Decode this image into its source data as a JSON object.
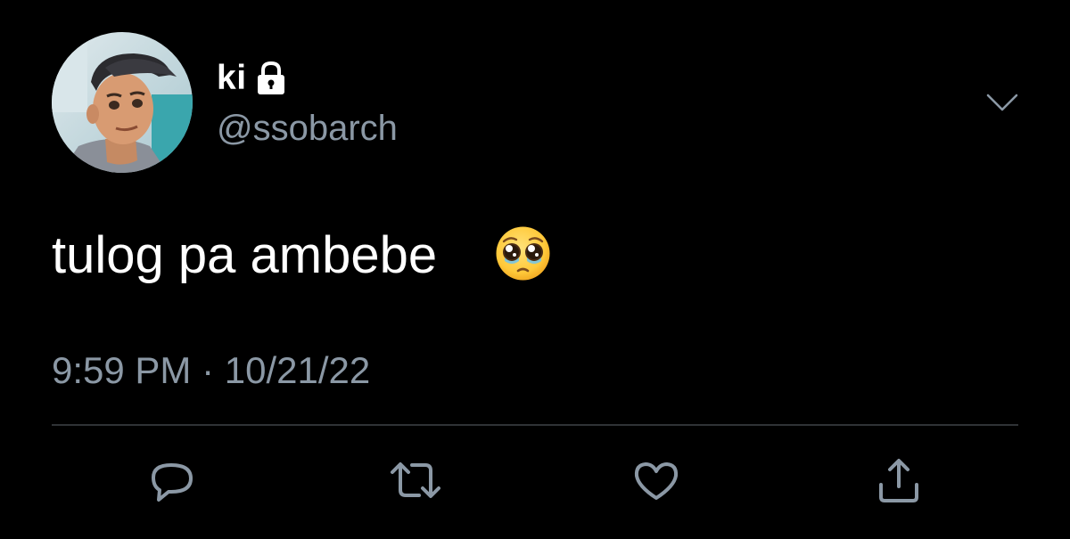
{
  "user": {
    "display_name": "ki",
    "handle": "@ssobarch",
    "protected_icon": "lock-icon",
    "avatar_icon": "avatar-image"
  },
  "tweet": {
    "text": "tulog pa ambebe",
    "emoji": "pleading-face-emoji",
    "timestamp": "9:59 PM · 10/21/22"
  },
  "menu": {
    "icon": "chevron-down-icon"
  },
  "actions": [
    {
      "name": "reply",
      "icon": "reply-icon"
    },
    {
      "name": "retweet",
      "icon": "retweet-icon"
    },
    {
      "name": "like",
      "icon": "heart-icon"
    },
    {
      "name": "share",
      "icon": "share-icon"
    }
  ],
  "colors": {
    "background": "#000000",
    "primary_text": "#ffffff",
    "secondary_text": "#8b98a5",
    "divider": "#2f3336"
  }
}
